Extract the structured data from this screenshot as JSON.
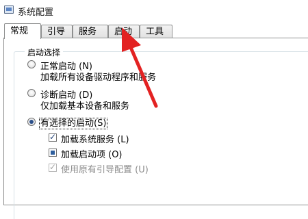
{
  "window": {
    "title": "系统配置",
    "icon": "system-config-icon"
  },
  "tabs": [
    "常规",
    "引导",
    "服务",
    "启动",
    "工具"
  ],
  "startup_group": {
    "label": "启动选择",
    "options": [
      {
        "label": "正常启动 (N)",
        "description": "加载所有设备驱动程序和服务",
        "checked": false
      },
      {
        "label": "诊断启动 (D)",
        "description": "仅加载基本设备和服务",
        "checked": false
      },
      {
        "label": "有选择的启动(S)",
        "checked": true
      }
    ],
    "sub_options": [
      {
        "label": "加载系统服务 (L)",
        "state": "checked"
      },
      {
        "label": "加载启动项 (O)",
        "state": "indeterminate"
      },
      {
        "label": "使用原有引导配置 (U)",
        "state": "checked-disabled"
      }
    ]
  },
  "annotation": {
    "color": "#e32222",
    "points_to": "启动"
  }
}
